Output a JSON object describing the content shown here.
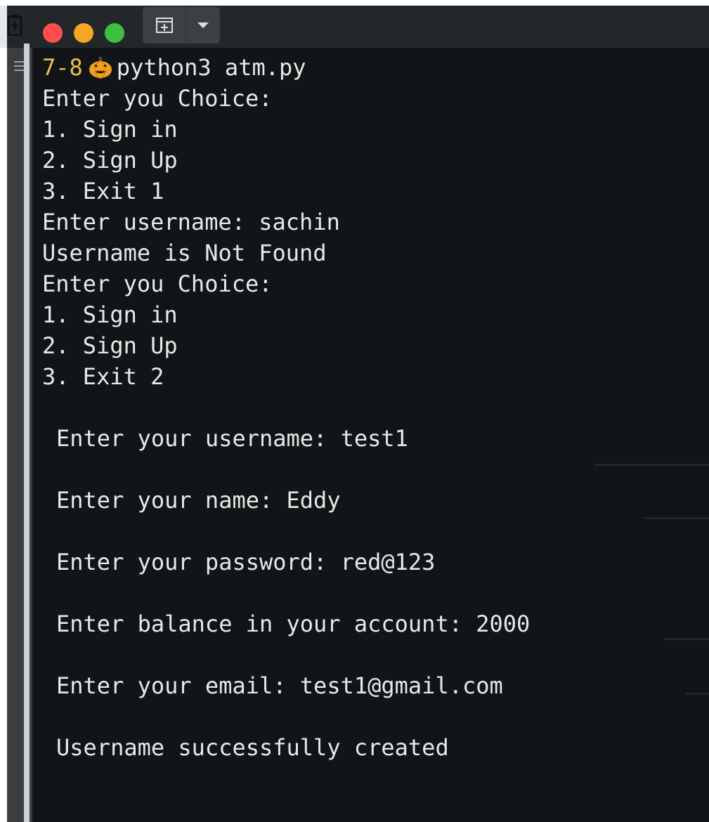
{
  "titlebar": {
    "traffic_colors": {
      "close": "#ff4d4d",
      "minimize": "#f5a623",
      "maximize": "#3cc13c"
    },
    "icons": [
      "battery-icon",
      "new-tab-icon",
      "chevron-down-icon",
      "hamburger-menu-icon"
    ]
  },
  "terminal": {
    "prompt": {
      "number": "7-8",
      "emoji": "pumpkin-icon",
      "command": "python3 atm.py"
    },
    "lines": [
      "Enter you Choice:",
      "1. Sign in",
      "2. Sign Up",
      "3. Exit 1",
      "Enter username: sachin",
      "Username is Not Found",
      "Enter you Choice:",
      "1. Sign in",
      "2. Sign Up",
      "3. Exit 2"
    ],
    "signup_lines": [
      "Enter your username: test1",
      "Enter your name: Eddy",
      "Enter your password: red@123",
      "Enter balance in your account: 2000",
      "Enter your email: test1@gmail.com",
      "Username successfully created"
    ],
    "colors": {
      "background": "#121517",
      "text": "#e8e8e8",
      "prompt_number": "#e8c04a"
    }
  }
}
